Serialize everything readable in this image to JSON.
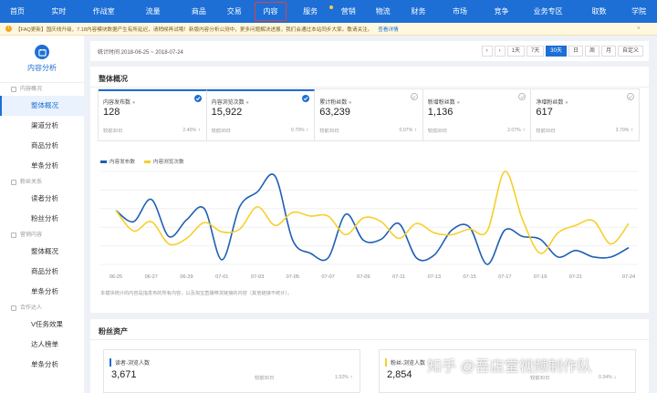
{
  "nav": {
    "items": [
      {
        "label": "首页",
        "w": 40
      },
      {
        "label": "实时",
        "w": 56
      },
      {
        "label": "作战室",
        "w": 48
      },
      {
        "label": "流量",
        "w": 66
      },
      {
        "label": "商品",
        "w": 40
      },
      {
        "label": "交易",
        "w": 42
      },
      {
        "label": "内容",
        "w": 42,
        "active": true
      },
      {
        "label": "服务",
        "w": 50,
        "dot": true
      },
      {
        "label": "营销",
        "w": 38
      },
      {
        "label": "物流",
        "w": 42
      },
      {
        "label": "财务",
        "w": 40
      },
      {
        "label": "市场",
        "w": 56
      },
      {
        "label": "竞争",
        "w": 40
      },
      {
        "label": "业务专区",
        "w": 68
      },
      {
        "label": "取数",
        "w": 50
      },
      {
        "label": "学院",
        "w": 42
      }
    ]
  },
  "notice": {
    "text": "【FAQ更新】国庆线升级，7.18内容模块数据产生有所延迟，请稍候再试哦！新版内容分析公测中，更多问题解决进展，我们会通过本站同步大家。敬请关注。",
    "link": "查看详情"
  },
  "sidebar": {
    "title": "内容分析",
    "groups": [
      {
        "label": "内容概况",
        "items": [
          {
            "label": "整体概况",
            "active": true
          },
          {
            "label": "渠道分析"
          },
          {
            "label": "商品分析"
          },
          {
            "label": "单条分析"
          }
        ]
      },
      {
        "label": "粉丝关系",
        "items": [
          {
            "label": "读者分析"
          },
          {
            "label": "粉丝分析"
          }
        ]
      },
      {
        "label": "营销内容",
        "items": [
          {
            "label": "整体概况"
          },
          {
            "label": "商品分析"
          },
          {
            "label": "单条分析"
          }
        ]
      },
      {
        "label": "合作达人",
        "items": [
          {
            "label": "V任务效果"
          },
          {
            "label": "达人榜单"
          },
          {
            "label": "单条分析"
          }
        ]
      }
    ]
  },
  "datebar": {
    "label": "统计时间 2018-06-25 ~ 2018-07-24",
    "periods": [
      {
        "label": "1天"
      },
      {
        "label": "7天"
      },
      {
        "label": "30天",
        "active": true
      },
      {
        "label": "日"
      },
      {
        "label": "周"
      },
      {
        "label": "月"
      },
      {
        "label": "自定义"
      }
    ],
    "nav_prev": "‹",
    "nav_next": "›"
  },
  "overview": {
    "title": "整体概况",
    "metrics": [
      {
        "label": "内容发布数",
        "value": "128",
        "compare": "较前30日",
        "pct": "2.40%",
        "selected": true,
        "checked": true
      },
      {
        "label": "内容浏览次数",
        "value": "15,922",
        "compare": "较前30日",
        "pct": "0.79%",
        "selected": true,
        "checked": true
      },
      {
        "label": "累计粉丝数",
        "value": "63,239",
        "compare": "较前30日",
        "pct": "0.07%",
        "checked": false
      },
      {
        "label": "新增粉丝数",
        "value": "1,136",
        "compare": "较前30日",
        "pct": "2.07%",
        "checked": false
      },
      {
        "label": "净增粉丝数",
        "value": "617",
        "compare": "较前30日",
        "pct": "3.70%",
        "checked": false
      }
    ],
    "note": "本模块统计的内容是指发布的所有内容，以及淘宝直播带货链接的内容（其他链接不统计）。"
  },
  "chart_data": {
    "type": "line",
    "x": [
      "06-25",
      "06-26",
      "06-27",
      "06-28",
      "06-29",
      "06-30",
      "07-01",
      "07-02",
      "07-03",
      "07-04",
      "07-05",
      "07-06",
      "07-07",
      "07-08",
      "07-09",
      "07-10",
      "07-11",
      "07-12",
      "07-13",
      "07-14",
      "07-15",
      "07-16",
      "07-17",
      "07-18",
      "07-19",
      "07-20",
      "07-21",
      "07-22",
      "07-23",
      "07-24"
    ],
    "x_ticks": [
      "06-25",
      "06-27",
      "06-29",
      "07-01",
      "07-03",
      "07-05",
      "07-07",
      "07-09",
      "07-11",
      "07-13",
      "07-15",
      "07-17",
      "07-19",
      "07-21",
      "07-24"
    ],
    "series": [
      {
        "name": "内容发布数",
        "color": "#1f5fb4",
        "values": [
          0.58,
          0.46,
          0.7,
          0.3,
          0.48,
          0.6,
          0.05,
          0.62,
          0.78,
          0.95,
          0.26,
          0.12,
          0.07,
          0.54,
          0.26,
          0.27,
          0.44,
          0.07,
          0.1,
          0.37,
          0.4,
          0.0,
          0.37,
          0.3,
          0.27,
          0.08,
          0.15,
          0.08,
          0.08,
          0.18
        ]
      },
      {
        "name": "内容浏览次数",
        "color": "#f5d02b",
        "values": [
          0.58,
          0.36,
          0.46,
          0.22,
          0.28,
          0.45,
          0.35,
          0.38,
          0.62,
          0.42,
          0.56,
          0.52,
          0.52,
          0.32,
          0.5,
          0.46,
          0.28,
          0.44,
          0.34,
          0.32,
          0.38,
          0.36,
          1.0,
          0.48,
          0.12,
          0.34,
          0.42,
          0.47,
          0.22,
          0.44
        ]
      }
    ],
    "ylim": [
      0,
      1
    ],
    "grid": true,
    "legend": "top-left"
  },
  "fans": {
    "title": "粉丝资产",
    "cards": [
      {
        "label": "读者-浏览人数",
        "value": "3,671",
        "compare": "较前30日",
        "pct": "1.52%"
      },
      {
        "label": "粉丝-浏览人数",
        "value": "2,854",
        "compare": "较前30日",
        "pct": "0.34%"
      }
    ]
  },
  "watermark": "知乎 @吾店堂视频制作队",
  "colors": {
    "brand": "#1d6fd6",
    "up": "#e0413a",
    "down": "#2aa55a",
    "series1": "#1f5fb4",
    "series2": "#f5d02b"
  }
}
